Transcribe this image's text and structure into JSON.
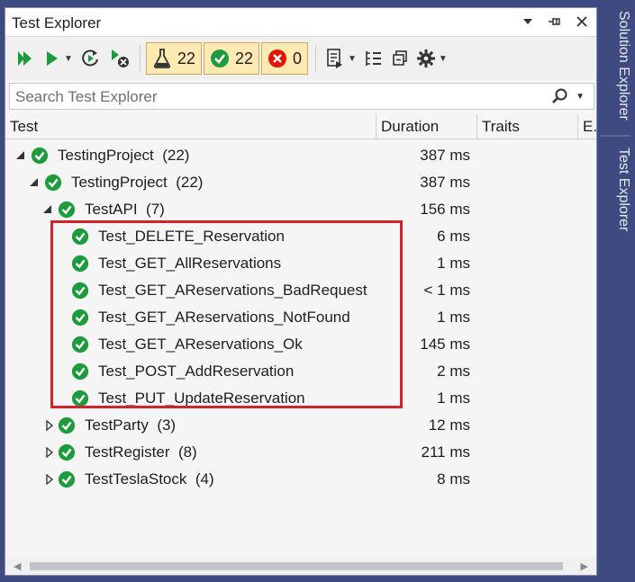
{
  "window": {
    "title": "Test Explorer"
  },
  "toolbar": {
    "total_count": "22",
    "passed_count": "22",
    "failed_count": "0"
  },
  "search": {
    "placeholder": "Search Test Explorer"
  },
  "columns": [
    "Test",
    "Duration",
    "Traits",
    "E."
  ],
  "rows": [
    {
      "name": "TestingProject",
      "count": "(22)",
      "duration": "387 ms",
      "level": 0,
      "expanded": true
    },
    {
      "name": "TestingProject",
      "count": "(22)",
      "duration": "387 ms",
      "level": 1,
      "expanded": true
    },
    {
      "name": "TestAPI",
      "count": "(7)",
      "duration": "156 ms",
      "level": 2,
      "expanded": true
    },
    {
      "name": "Test_DELETE_Reservation",
      "count": "",
      "duration": "6 ms",
      "level": 3,
      "expanded": null
    },
    {
      "name": "Test_GET_AllReservations",
      "count": "",
      "duration": "1 ms",
      "level": 3,
      "expanded": null
    },
    {
      "name": "Test_GET_AReservations_BadRequest",
      "count": "",
      "duration": "< 1 ms",
      "level": 3,
      "expanded": null
    },
    {
      "name": "Test_GET_AReservations_NotFound",
      "count": "",
      "duration": "1 ms",
      "level": 3,
      "expanded": null
    },
    {
      "name": "Test_GET_AReservations_Ok",
      "count": "",
      "duration": "145 ms",
      "level": 3,
      "expanded": null
    },
    {
      "name": "Test_POST_AddReservation",
      "count": "",
      "duration": "2 ms",
      "level": 3,
      "expanded": null
    },
    {
      "name": "Test_PUT_UpdateReservation",
      "count": "",
      "duration": "1 ms",
      "level": 3,
      "expanded": null
    },
    {
      "name": "TestParty",
      "count": "(3)",
      "duration": "12 ms",
      "level": 2,
      "expanded": false
    },
    {
      "name": "TestRegister",
      "count": "(8)",
      "duration": "211 ms",
      "level": 2,
      "expanded": false
    },
    {
      "name": "TestTeslaStock",
      "count": "(4)",
      "duration": "8 ms",
      "level": 2,
      "expanded": false
    }
  ],
  "side_tabs": [
    "Solution Explorer",
    "Test Explorer"
  ],
  "colors": {
    "pass_green": "#1e9b3c",
    "fail_red": "#e51400",
    "accent_border": "#d2232a",
    "side_bar": "#3f4a80"
  }
}
